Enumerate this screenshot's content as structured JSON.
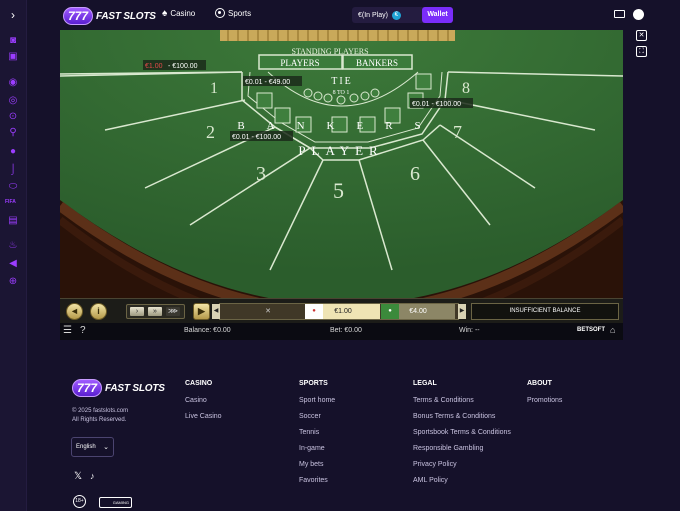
{
  "topbar": {
    "logo_number": "777",
    "logo_text": "FAST SLOTS",
    "nav_casino": "Casino",
    "nav_sports": "Sports",
    "balance_label": "€(In Play)",
    "coin_symbol": "€",
    "wallet_label": "Wallet"
  },
  "sidebar": {
    "fifa_label": "FIFA",
    "icons": [
      "game-icon",
      "casino-icon",
      "star-icon",
      "broadcast-icon",
      "soccer-icon",
      "tennis-icon",
      "basketball-icon",
      "hockey-icon",
      "football-icon",
      "fifa-icon",
      "fire-icon",
      "megaphone-icon",
      "gamepad-icon"
    ]
  },
  "game": {
    "standing_players": "STANDING PLAYERS",
    "players_label": "PLAYERS",
    "bankers_label": "BANKERS",
    "tie_label": "TIE",
    "tie_odds": "8 TO 1",
    "bankers_word": "BANKERS",
    "player_word": "PLAYER",
    "seat_numbers": [
      "1",
      "2",
      "3",
      "5",
      "6",
      "7",
      "8"
    ],
    "limit_main": "€1.00 - €100.00",
    "limit_main_prefix": "€1.00",
    "limit_main_suffix": " - €100.00",
    "limit_tie": "€0.01 - €49.00",
    "limit_bankers": "€0.01 - €100.00",
    "limit_players": "€0.01 - €100.00"
  },
  "controls": {
    "sound_icon": "speaker-icon",
    "info_label": "i",
    "chip_value_1": "€1.00",
    "chip_value_2": "€4.00",
    "insufficient_balance": "INSUFFICIENT BALANCE"
  },
  "statusbar": {
    "balance": "Balance: €0.00",
    "bet": "Bet: €0.00",
    "win": "Win: --",
    "brand": "BETSOFT"
  },
  "footer": {
    "copyright_line1": "© 2025 fastslots.com",
    "copyright_line2": "All Rights Reserved.",
    "language": "English",
    "casino": {
      "heading": "CASINO",
      "links": [
        "Casino",
        "Live Casino"
      ]
    },
    "sports": {
      "heading": "SPORTS",
      "links": [
        "Sport home",
        "Soccer",
        "Tennis",
        "In-game",
        "My bets",
        "Favorites"
      ]
    },
    "legal": {
      "heading": "LEGAL",
      "links": [
        "Terms & Conditions",
        "Bonus Terms & Conditions",
        "Sportsbook Terms & Conditions",
        "Responsible Gambling",
        "Privacy Policy",
        "AML Policy"
      ]
    },
    "about": {
      "heading": "ABOUT",
      "links": [
        "Promotions"
      ]
    },
    "age_badge": "18+",
    "rg_label": "GAMING"
  }
}
